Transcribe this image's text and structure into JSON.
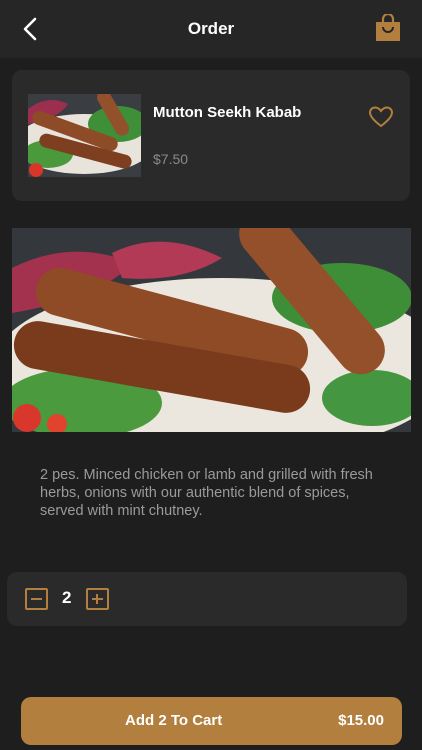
{
  "header": {
    "title": "Order",
    "back_icon": "chevron-left-icon",
    "bag_icon": "shopping-bag-icon"
  },
  "item": {
    "name": "Mutton Seekh Kabab",
    "price": "$7.50",
    "favorite_icon": "heart-outline-icon"
  },
  "description": "2 pes. Minced chicken or lamb and grilled with fresh herbs, onions with our authentic blend of spices, served with mint chutney.",
  "quantity": {
    "value": "2",
    "decrement_icon": "minus-square-icon",
    "increment_icon": "plus-square-icon"
  },
  "cart": {
    "label": "Add 2 To Cart",
    "total": "$15.00"
  },
  "colors": {
    "accent": "#b27f3f",
    "background": "#1e1e1e",
    "card": "#2a2a2a"
  }
}
